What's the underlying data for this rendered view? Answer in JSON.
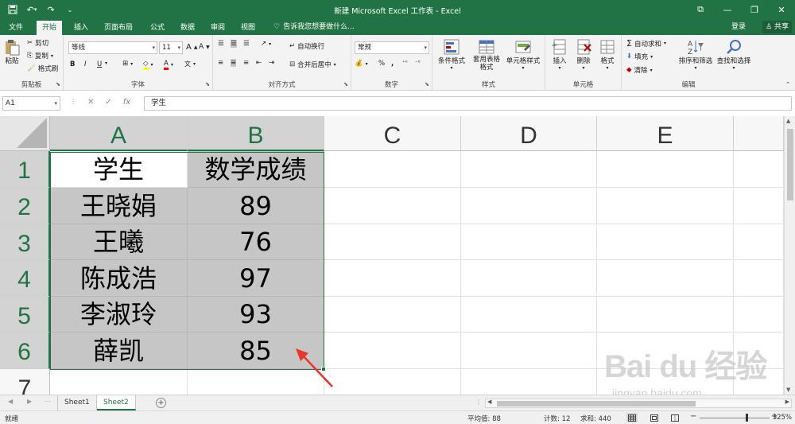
{
  "app": {
    "title": "新建 Microsoft Excel 工作表 - Excel",
    "accent_color": "#217346"
  },
  "tabs": [
    {
      "label": "文件",
      "active": false
    },
    {
      "label": "开始",
      "active": true
    },
    {
      "label": "插入",
      "active": false
    },
    {
      "label": "页面布局",
      "active": false
    },
    {
      "label": "公式",
      "active": false
    },
    {
      "label": "数据",
      "active": false
    },
    {
      "label": "审阅",
      "active": false
    },
    {
      "label": "视图",
      "active": false
    }
  ],
  "tell_me": "告诉我您想要做什么...",
  "account": {
    "login": "登录",
    "share": "共享"
  },
  "ribbon": {
    "clipboard": {
      "label": "剪贴板",
      "paste": "粘贴",
      "cut": "剪切",
      "copy": "复制",
      "format_painter": "格式刷"
    },
    "font": {
      "label": "字体",
      "name": "等线",
      "size": "11",
      "bold": "B",
      "italic": "I",
      "underline": "U"
    },
    "alignment": {
      "label": "对齐方式",
      "wrap": "自动换行",
      "merge": "合并后居中"
    },
    "number": {
      "label": "数字",
      "format": "常规",
      "percent": "%",
      "comma": ","
    },
    "styles": {
      "label": "样式",
      "conditional": "条件格式",
      "table": "套用表格格式",
      "cell_styles": "单元格样式"
    },
    "cells": {
      "label": "单元格",
      "insert": "插入",
      "delete": "删除",
      "format": "格式"
    },
    "editing": {
      "label": "编辑",
      "autosum": "自动求和",
      "fill": "填充",
      "clear": "清除",
      "sort_filter": "排序和筛选",
      "find_select": "查找和选择"
    }
  },
  "formula_bar": {
    "name_box": "A1",
    "content": "学生"
  },
  "columns": [
    "A",
    "B",
    "C",
    "D",
    "E"
  ],
  "rows": [
    "1",
    "2",
    "3",
    "4",
    "5",
    "6",
    "7"
  ],
  "table": {
    "headers": [
      "学生",
      "数学成绩"
    ],
    "rows": [
      [
        "王晓娟",
        "89"
      ],
      [
        "王曦",
        "76"
      ],
      [
        "陈成浩",
        "97"
      ],
      [
        "李淑玲",
        "93"
      ],
      [
        "薛凯",
        "85"
      ]
    ]
  },
  "sheets": [
    {
      "label": "Sheet1",
      "active": false
    },
    {
      "label": "Sheet2",
      "active": true
    }
  ],
  "status": {
    "ready": "就绪",
    "average": "平均值: 88",
    "count": "计数: 12",
    "sum": "求和: 440",
    "zoom": "325%"
  },
  "watermark": {
    "brand": "Bai du 经验",
    "url": "jingyan.baidu.com"
  }
}
